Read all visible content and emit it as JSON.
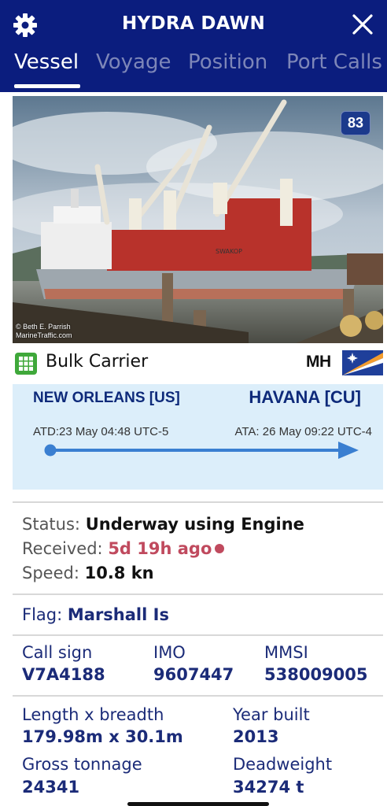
{
  "header": {
    "title": "HYDRA DAWN",
    "tabs": [
      {
        "label": "Vessel"
      },
      {
        "label": "Voyage"
      },
      {
        "label": "Position"
      },
      {
        "label": "Port Calls"
      }
    ],
    "colors": {
      "background": "#0b1d7e",
      "active_tab": "#ffffff",
      "inactive_tab": "#7d86b8"
    },
    "icons": {
      "left": "gear-icon",
      "right": "close-icon"
    }
  },
  "photo": {
    "badge": "83",
    "credit_line1": "© Beth E. Parrish",
    "credit_line2": "MarineTraffic.com",
    "hull_name": "SWAKOP"
  },
  "vessel_type": {
    "label": "Bulk Carrier",
    "flag_code": "MH",
    "icon": "grid-icon",
    "icon_color": "#3fa83a"
  },
  "voyage": {
    "from_port": "NEW ORLEANS [US]",
    "to_port": "HAVANA [CU]",
    "atd": "ATD:23 May 04:48 UTC-5",
    "ata": "ATA: 26 May 09:22 UTC-4",
    "progress": 1.0,
    "colors": {
      "background": "#dceefa",
      "route": "#3a7fd1"
    }
  },
  "status": {
    "status_label": "Status:",
    "status_value": "Underway using Engine",
    "received_label": "Received:",
    "received_value": "5d 19h ago",
    "speed_label": "Speed:",
    "speed_value": "10.8 kn",
    "received_color": "#c04a5e"
  },
  "flag": {
    "label": "Flag:",
    "value": "Marshall Is"
  },
  "ids": {
    "callsign_label": "Call sign",
    "callsign_value": "V7A4188",
    "imo_label": "IMO",
    "imo_value": "9607447",
    "mmsi_label": "MMSI",
    "mmsi_value": "538009005"
  },
  "dimensions": {
    "length_label": "Length x breadth",
    "length_value": "179.98m x 30.1m",
    "year_label": "Year built",
    "year_value": "2013",
    "gross_label": "Gross tonnage",
    "gross_value": "24341",
    "dwt_label": "Deadweight",
    "dwt_value": "34274 t"
  }
}
